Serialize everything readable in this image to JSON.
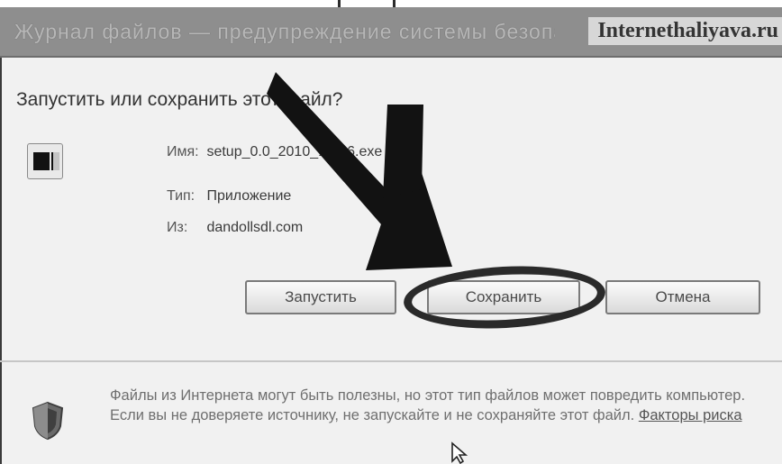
{
  "dialog": {
    "title": "Журнал файлов — предупреждение системы безопасности",
    "watermark": "Internethaliyava.ru",
    "question": "Запустить или сохранить этот файл?",
    "file": {
      "name_label": "Имя:",
      "name_value": "setup_0.0_2010_15-36.exe",
      "type_label": "Тип:",
      "type_value": "Приложение",
      "from_label": "Из:",
      "from_value": "dandollsdl.com"
    },
    "buttons": {
      "run": "Запустить",
      "save": "Сохранить",
      "cancel": "Отмена"
    },
    "warning": {
      "text": "Файлы из Интернета могут быть полезны, но этот тип файлов может повредить компьютер. Если вы не доверяете источнику, не запускайте и не сохраняйте этот файл.",
      "link": "Факторы риска"
    }
  },
  "icons": {
    "file": "application-file-icon",
    "shield": "security-shield-icon",
    "arrow": "pointer-arrow-annotation",
    "cursor": "mouse-cursor-icon"
  }
}
